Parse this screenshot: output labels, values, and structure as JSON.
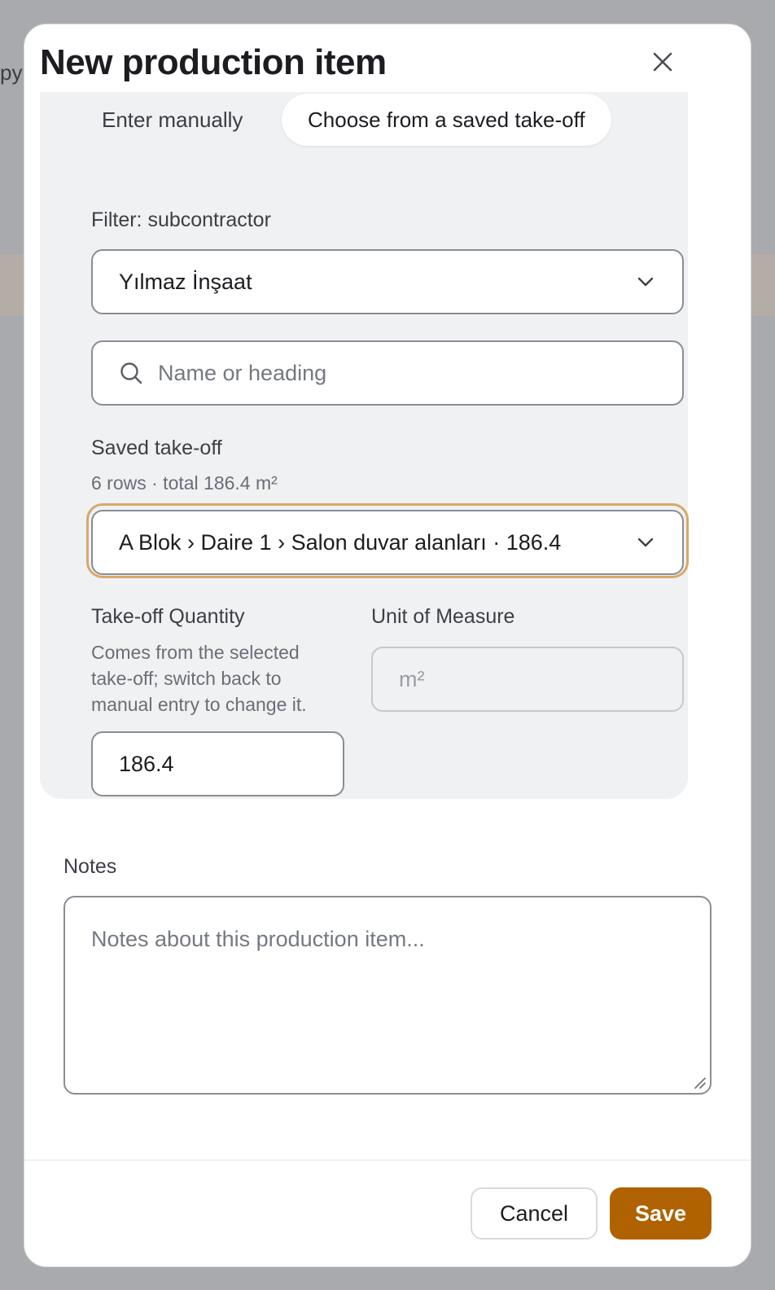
{
  "background": {
    "partial_text": "py"
  },
  "dialog": {
    "title": "New production item",
    "close_icon": "close-icon"
  },
  "source_tabs": [
    {
      "label": "Enter manually",
      "selected": false
    },
    {
      "label": "Choose from a saved take-off",
      "selected": true
    }
  ],
  "filter": {
    "label": "Filter: subcontractor",
    "selected": "Yılmaz İnşaat"
  },
  "search": {
    "placeholder": "Name or heading",
    "icon": "search-icon"
  },
  "saved_takeoff": {
    "label": "Saved take-off",
    "summary": "6 rows · total 186.4 m²",
    "selected": "A Blok › Daire 1 › Salon duvar alanları · 186.4"
  },
  "quantity": {
    "label": "Take-off Quantity",
    "help": "Comes from the selected take-off; switch back to manual entry to change it.",
    "value": "186.4"
  },
  "unit": {
    "label": "Unit of Measure",
    "value": "m²"
  },
  "notes": {
    "label": "Notes",
    "placeholder": "Notes about this production item..."
  },
  "footer": {
    "cancel_label": "Cancel",
    "save_label": "Save"
  },
  "colors": {
    "accent": "#b06200",
    "focus_ring": "#d8a86a",
    "panel_bg": "#f0f1f3"
  }
}
